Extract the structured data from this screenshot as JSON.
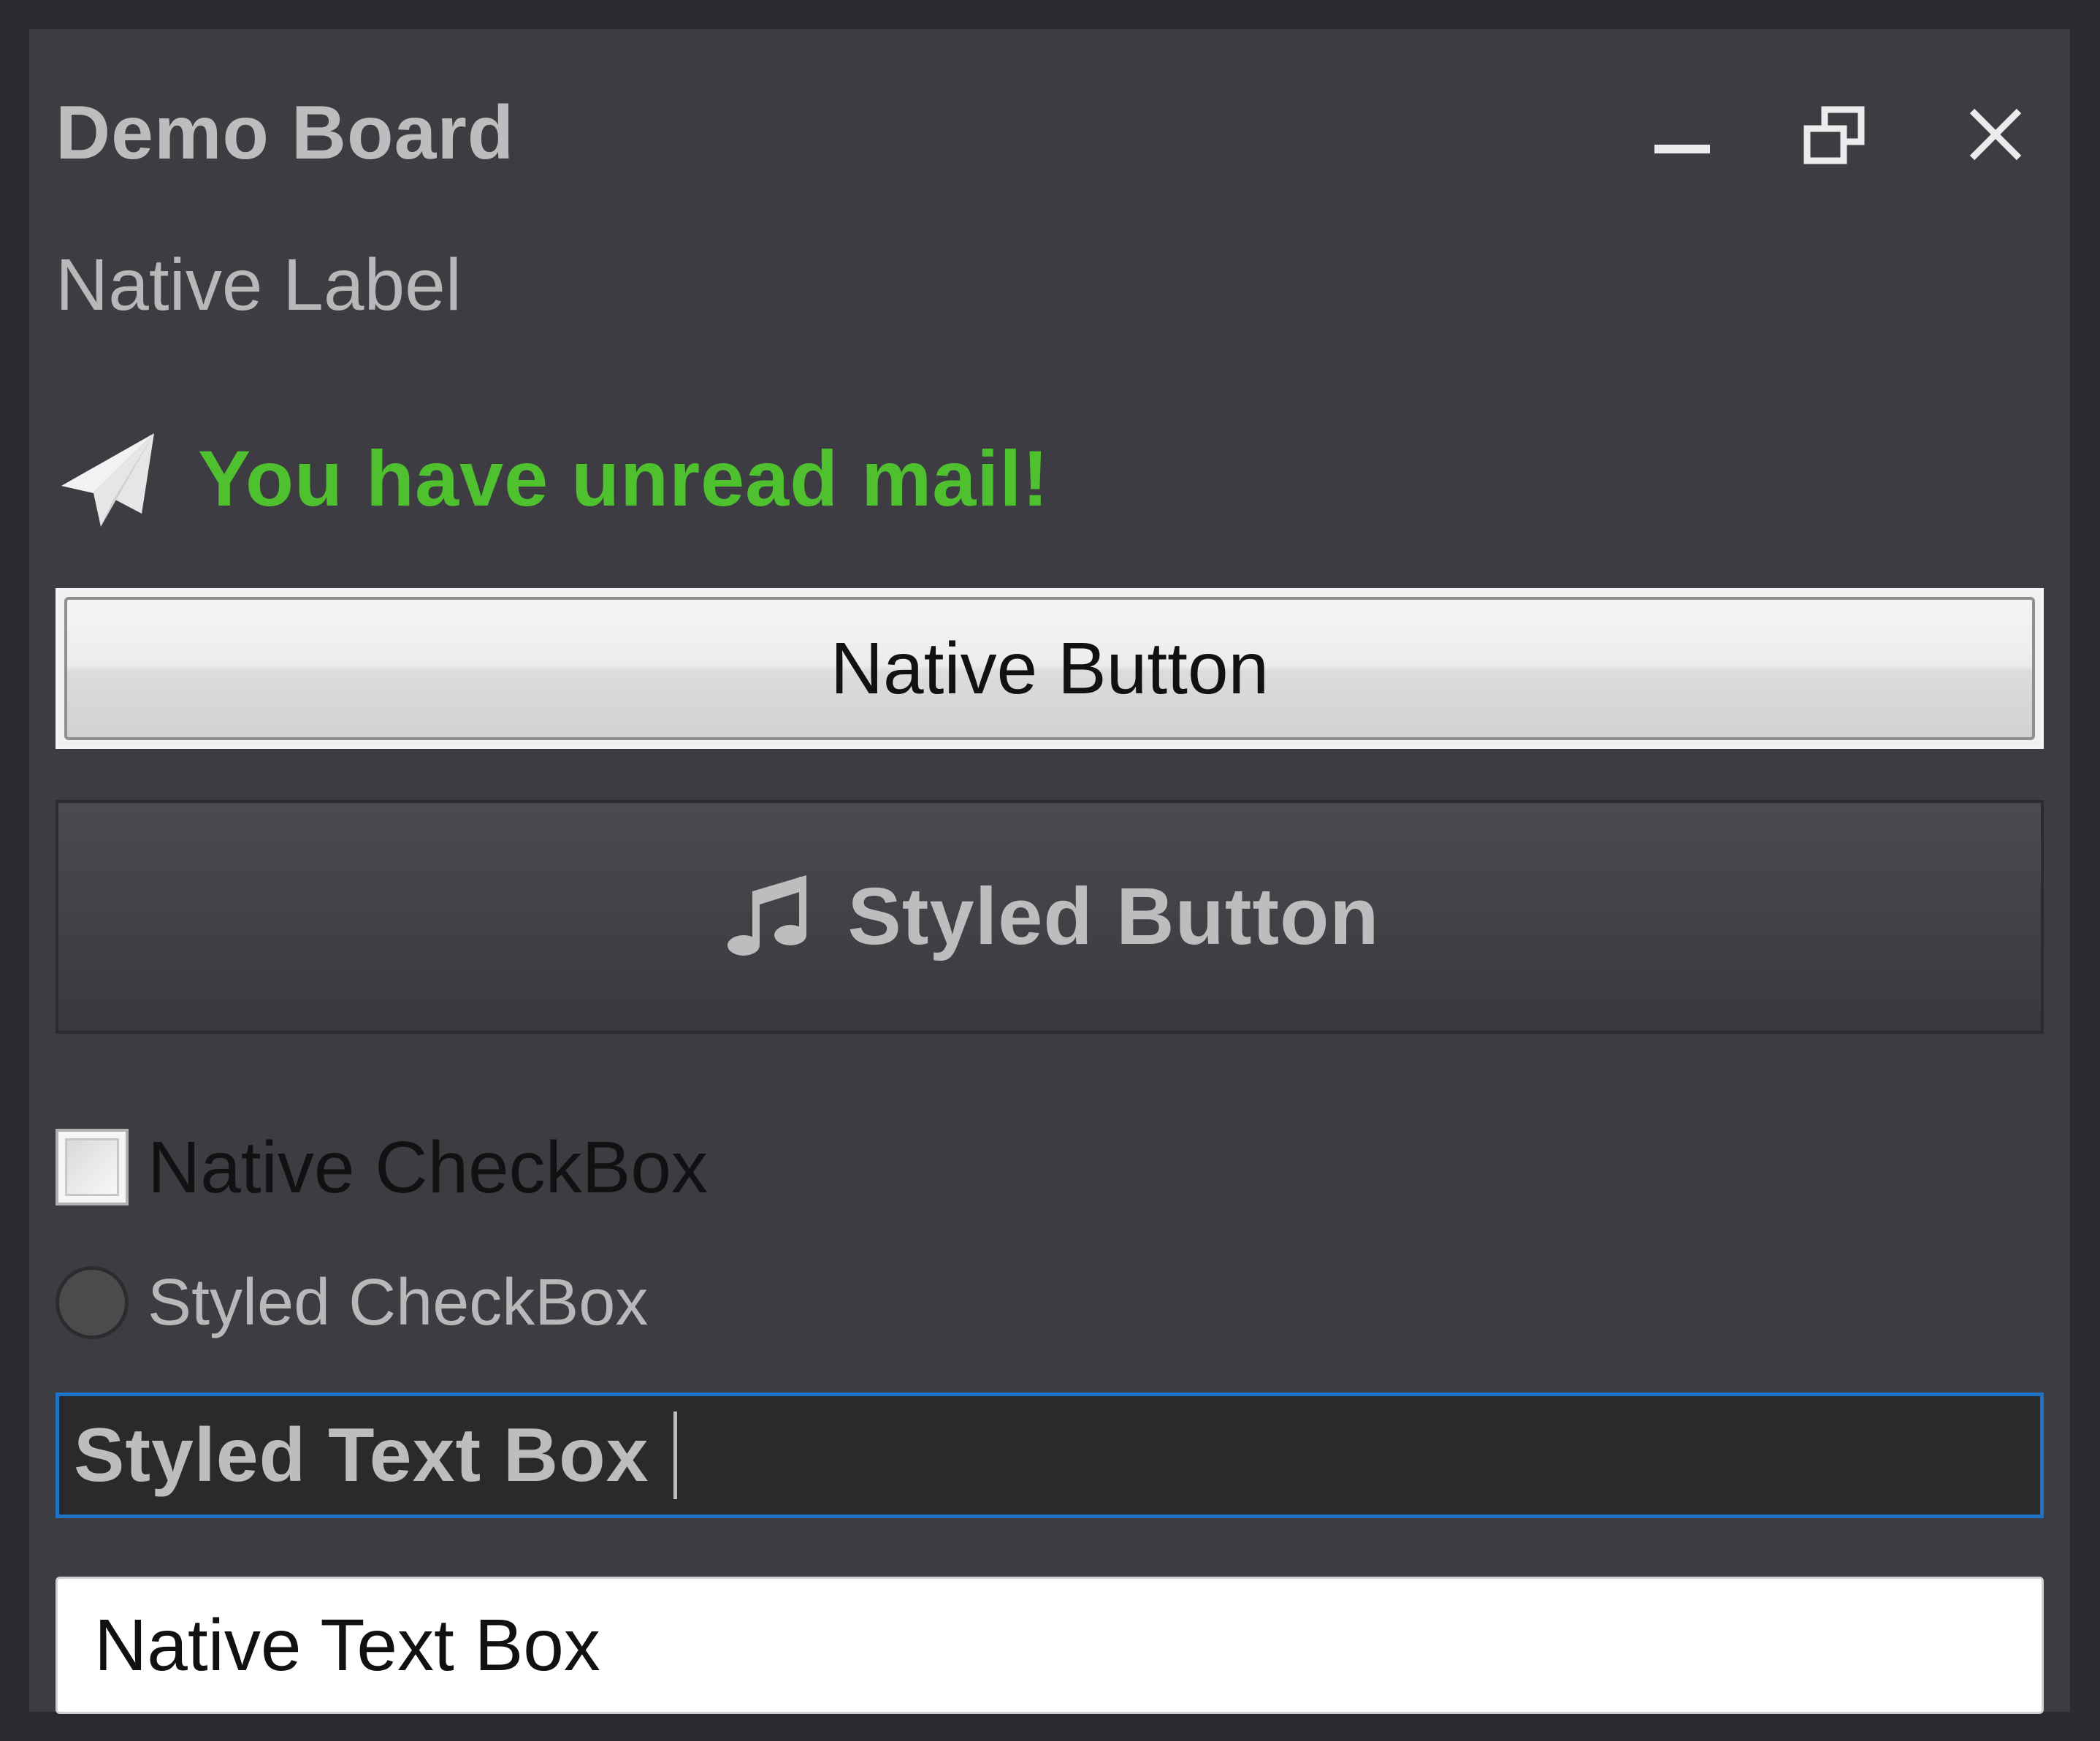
{
  "window": {
    "title": "Demo Board",
    "controls": {
      "minimize_icon": "minimize-icon",
      "restore_icon": "restore-icon",
      "close_icon": "close-icon"
    }
  },
  "native_label": {
    "text": "Native Label"
  },
  "mail_notice": {
    "icon": "paper-plane-icon",
    "text": "You have unread mail!",
    "color": "#4fc12e"
  },
  "native_button": {
    "label": "Native Button"
  },
  "styled_button": {
    "icon": "music-note-icon",
    "label": "Styled Button"
  },
  "native_checkbox": {
    "label": "Native CheckBox",
    "checked": false
  },
  "styled_checkbox": {
    "label": "Styled CheckBox",
    "checked": false
  },
  "styled_text_box": {
    "value": "Styled Text Box",
    "focused": true,
    "border_color": "#1b74c8"
  },
  "native_text_box": {
    "value": "Native Text Box"
  },
  "colors": {
    "window_background": "#3c3c42",
    "outer_frame": "#2b2b2f",
    "text_light": "#bdbdbd"
  }
}
